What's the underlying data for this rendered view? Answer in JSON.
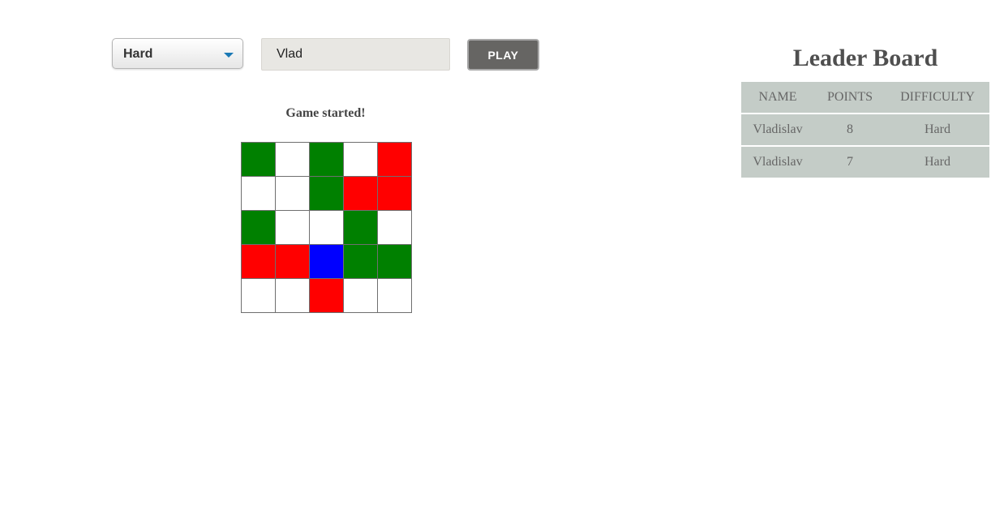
{
  "controls": {
    "difficulty_selected": "Hard",
    "player_name_value": "Vlad",
    "play_label": "PLAY"
  },
  "game": {
    "status": "Game started!",
    "colors": {
      "G": "#008000",
      "R": "#ff0000",
      "B": "#0000ff",
      "W": "#ffffff"
    },
    "grid": [
      [
        "G",
        "W",
        "G",
        "W",
        "R"
      ],
      [
        "W",
        "W",
        "G",
        "R",
        "R"
      ],
      [
        "G",
        "W",
        "W",
        "G",
        "W"
      ],
      [
        "R",
        "R",
        "B",
        "G",
        "G"
      ],
      [
        "W",
        "W",
        "R",
        "W",
        "W"
      ]
    ]
  },
  "leaderboard": {
    "title": "Leader Board",
    "headers": {
      "name": "NAME",
      "points": "POINTS",
      "difficulty": "DIFFICULTY"
    },
    "rows": [
      {
        "name": "Vladislav",
        "points": "8",
        "difficulty": "Hard"
      },
      {
        "name": "Vladislav",
        "points": "7",
        "difficulty": "Hard"
      }
    ]
  }
}
